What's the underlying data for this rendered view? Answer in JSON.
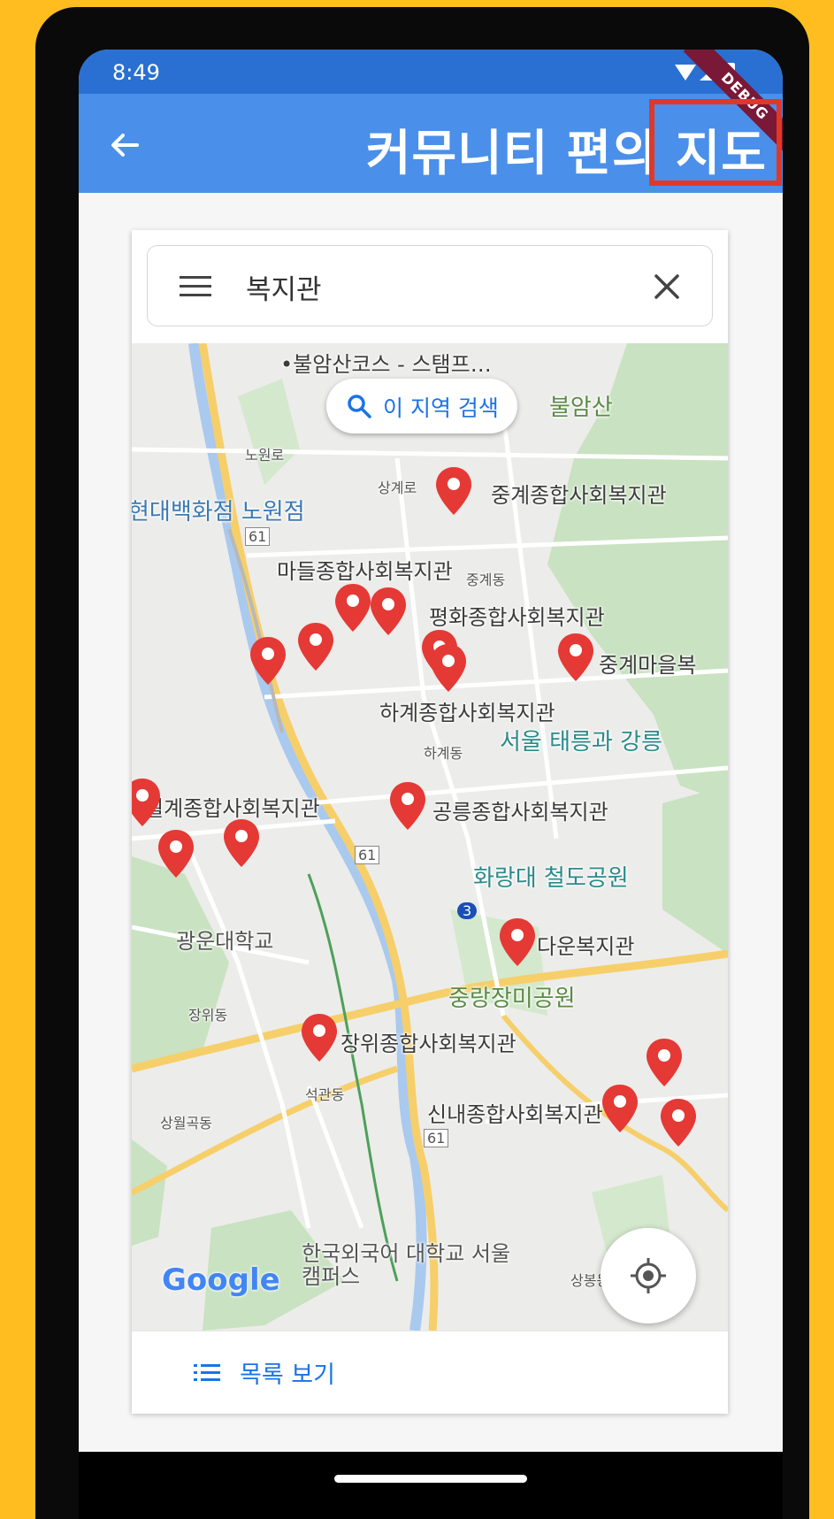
{
  "status_bar": {
    "time": "8:49",
    "debug_ribbon": "DEBUG"
  },
  "app_bar": {
    "title": "커뮤니티 편의 지도"
  },
  "search": {
    "query": "복지관"
  },
  "map": {
    "search_area_button": "이 지역 검색",
    "labels": {
      "top_trail": "•불암산코스 - 스탬프…",
      "bulamsan": "불암산",
      "nowonro": "노원로",
      "department_store": "현대백화점 노원점",
      "sanggyero": "상계로",
      "road_61_a": "61",
      "road_61_b": "61",
      "road_61_c": "61",
      "junggye_dong": "중계동",
      "hagye_dong": "하계동",
      "taereung": "서울 태릉과 강릉",
      "hwarangdae": "화랑대 철도공원",
      "kwangwoon": "광운대학교",
      "jungnang_park": "중랑장미공원",
      "jangwi_dong": "장위동",
      "seokgwan_dong": "석관동",
      "sangwolgok_dong": "상월곡동",
      "hufs": "한국외국어 대학교 서울캠퍼스",
      "sangbong_dong": "상봉동",
      "subway_3": "3",
      "google": "Google"
    },
    "places": [
      "중계종합사회복지관",
      "마들종합사회복지관",
      "평화종합사회복지관",
      "중계마을복",
      "하계종합사회복지관",
      "월계종합사회복지관",
      "공릉종합사회복지관",
      "다운복지관",
      "장위종합사회복지관",
      "신내종합사회복지관"
    ]
  },
  "list_button": {
    "label": "목록 보기"
  },
  "colors": {
    "status_bar": "#2970D2",
    "app_bar": "#4A8FEA",
    "highlight": "#E03828",
    "pin": "#E53935",
    "accent": "#1a73e8"
  },
  "icons": [
    "back-arrow-icon",
    "menu-icon",
    "close-icon",
    "search-icon",
    "my-location-icon",
    "list-icon",
    "map-pin-icon"
  ]
}
